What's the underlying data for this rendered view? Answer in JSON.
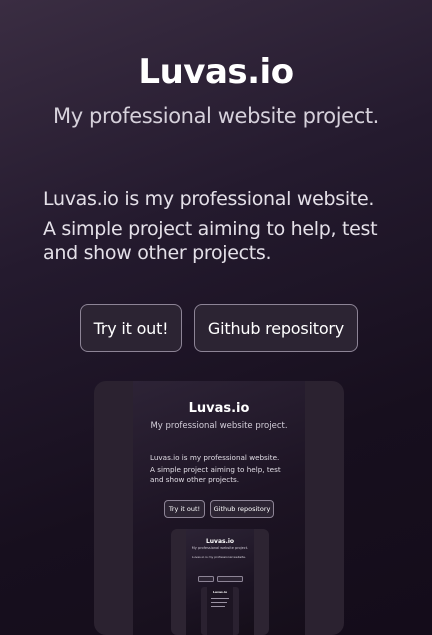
{
  "header": {
    "title": "Luvas.io",
    "subtitle": "My professional website project."
  },
  "description": {
    "line1": "Luvas.io is my professional website.",
    "line2": "A simple project aiming to help, test",
    "line3": "and show other projects."
  },
  "buttons": {
    "try_label": "Try it out!",
    "github_label": "Github repository"
  },
  "preview": {
    "title": "Luvas.io",
    "subtitle": "My professional website project.",
    "line1": "Luvas.io is my professional website.",
    "line2": "A simple project aiming to help, test",
    "line3": "and show other projects.",
    "try_label": "Try it out!",
    "github_label": "Github repository"
  },
  "colors": {
    "background": "#1a1220",
    "button_border": "#8d8496",
    "button_background": "#2c2433"
  }
}
